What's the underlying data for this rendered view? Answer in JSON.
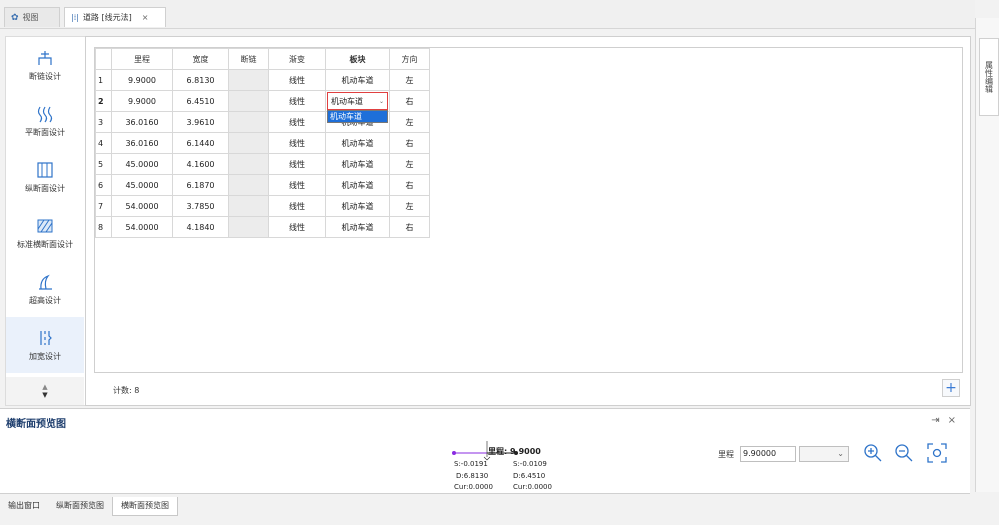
{
  "tabs": [
    {
      "label": "视图",
      "icon": "gear-icon"
    },
    {
      "label": "道路 [线元法]",
      "icon": "road-icon",
      "close": "×"
    }
  ],
  "sidebar": {
    "items": [
      {
        "label": "断链设计",
        "icon": "chain-break-icon"
      },
      {
        "label": "平断面设计",
        "icon": "plan-curve-icon"
      },
      {
        "label": "纵断面设计",
        "icon": "profile-icon"
      },
      {
        "label": "标准横断面设计",
        "icon": "hatch-section-icon"
      },
      {
        "label": "超高设计",
        "icon": "superelevation-icon"
      },
      {
        "label": "加宽设计",
        "icon": "widening-icon"
      }
    ]
  },
  "grid": {
    "headers": [
      "里程",
      "宽度",
      "断链",
      "渐变",
      "板块",
      "方向"
    ],
    "rows": [
      {
        "n": "1",
        "mileage": "9.9000",
        "width": "6.8130",
        "chain": "",
        "transition": "线性",
        "block": "机动车道",
        "dir": "左"
      },
      {
        "n": "2",
        "mileage": "9.9000",
        "width": "6.4510",
        "chain": "",
        "transition": "线性",
        "block": "机动车道",
        "dir": "右"
      },
      {
        "n": "3",
        "mileage": "36.0160",
        "width": "3.9610",
        "chain": "",
        "transition": "线性",
        "block": "机动车道",
        "dir": "左"
      },
      {
        "n": "4",
        "mileage": "36.0160",
        "width": "6.1440",
        "chain": "",
        "transition": "线性",
        "block": "机动车道",
        "dir": "右"
      },
      {
        "n": "5",
        "mileage": "45.0000",
        "width": "4.1600",
        "chain": "",
        "transition": "线性",
        "block": "机动车道",
        "dir": "左"
      },
      {
        "n": "6",
        "mileage": "45.0000",
        "width": "6.1870",
        "chain": "",
        "transition": "线性",
        "block": "机动车道",
        "dir": "右"
      },
      {
        "n": "7",
        "mileage": "54.0000",
        "width": "3.7850",
        "chain": "",
        "transition": "线性",
        "block": "机动车道",
        "dir": "左"
      },
      {
        "n": "8",
        "mileage": "54.0000",
        "width": "4.1840",
        "chain": "",
        "transition": "线性",
        "block": "机动车道",
        "dir": "右"
      }
    ],
    "dropdown_option": "机动车道",
    "count_label": "计数: 8",
    "add_label": "+"
  },
  "right_rail": {
    "label": "属性编辑"
  },
  "preview": {
    "title": "横断面预览图",
    "pin": "⇥",
    "close": "×",
    "mileage_text": "里程: 9.9000",
    "left_s": "S:-0.0191",
    "left_d": "D:6.8130",
    "left_cur": "Cur:0.0000",
    "right_s": "S:-0.0109",
    "right_d": "D:6.4510",
    "right_cur": "Cur:0.0000",
    "mileage_label": "里程",
    "mileage_value": "9.90000"
  },
  "bottom_tabs": [
    "输出窗口",
    "纵断面预览图",
    "横断面预览图"
  ],
  "colors": {
    "accent": "#1e6fd9",
    "highlight_border": "#e04040",
    "title": "#1f3f6e"
  }
}
